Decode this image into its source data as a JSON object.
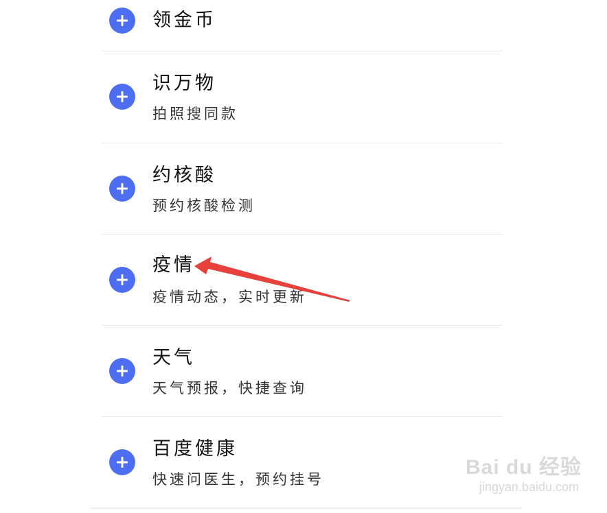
{
  "list": {
    "items": [
      {
        "title": "领金币",
        "subtitle": ""
      },
      {
        "title": "识万物",
        "subtitle": "拍照搜同款"
      },
      {
        "title": "约核酸",
        "subtitle": "预约核酸检测"
      },
      {
        "title": "疫情",
        "subtitle": "疫情动态，实时更新"
      },
      {
        "title": "天气",
        "subtitle": "天气预报，快捷查询"
      },
      {
        "title": "百度健康",
        "subtitle": "快速问医生，预约挂号"
      }
    ]
  },
  "colors": {
    "add_button": "#4e6ef2",
    "arrow": "#e8413c",
    "divider": "#ececec"
  },
  "icons": {
    "add": "plus-icon",
    "annotation": "red-arrow-icon"
  },
  "watermark": {
    "logo": "Bai du 经验",
    "url": "jingyan.baidu.com"
  }
}
